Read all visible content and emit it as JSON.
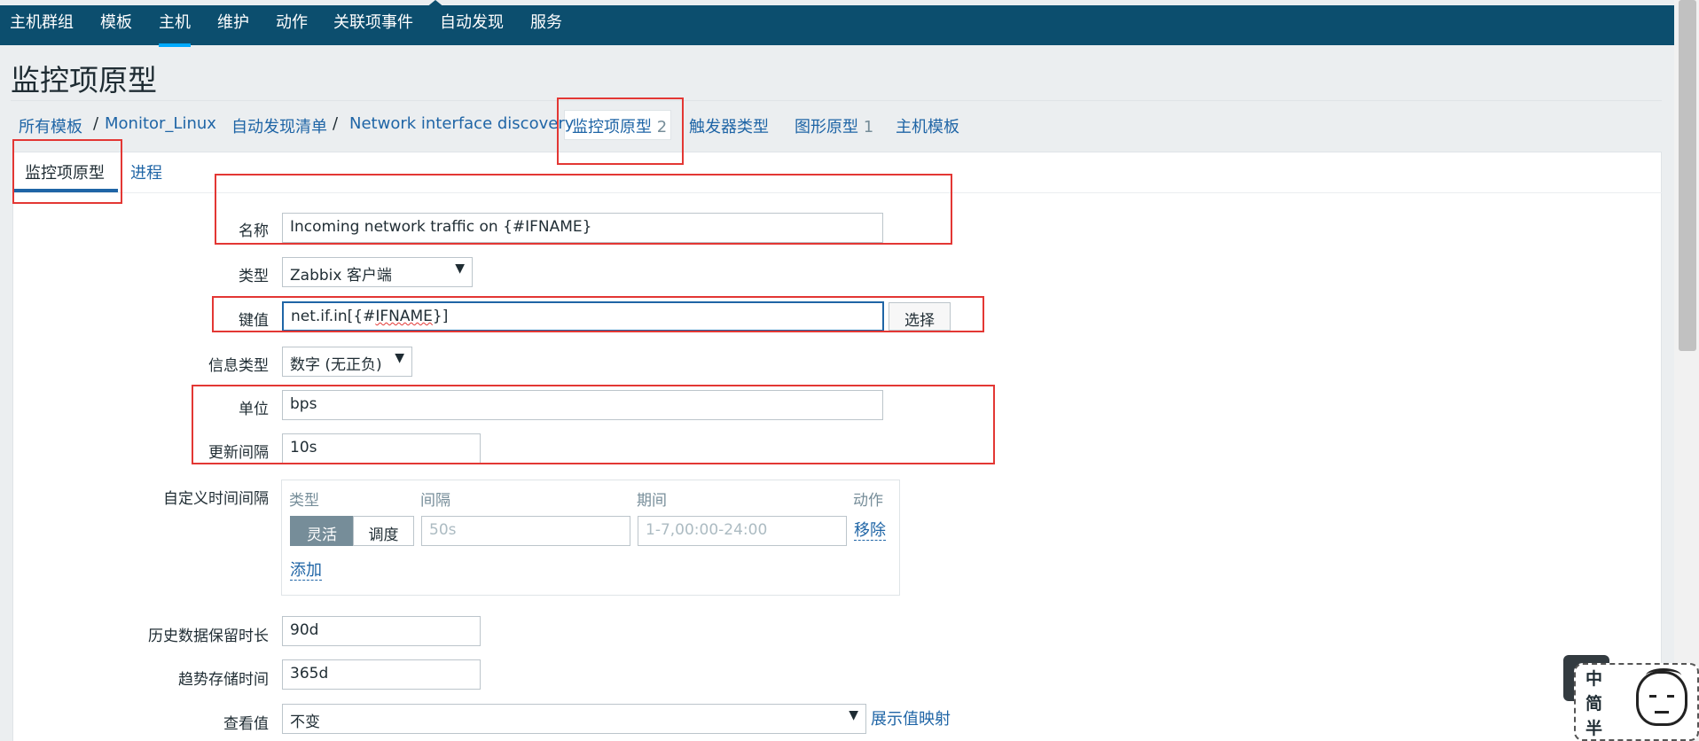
{
  "nav": {
    "items": [
      "主机群组",
      "模板",
      "主机",
      "维护",
      "动作",
      "关联项事件",
      "自动发现",
      "服务"
    ],
    "active": "主机"
  },
  "page": {
    "title": "监控项原型"
  },
  "breadcrumb": {
    "all_templates": "所有模板",
    "sep": "/",
    "template": "Monitor_Linux",
    "discovery_list": "自动发现清单",
    "discovery_rule": "Network interface discovery",
    "item_prototypes": "监控项原型",
    "item_prototypes_count": "2",
    "trigger_prototypes": "触发器类型",
    "graph_prototypes": "图形原型",
    "graph_prototypes_count": "1",
    "host_templates": "主机模板"
  },
  "tabs": [
    "监控项原型",
    "进程"
  ],
  "form": {
    "name_label": "名称",
    "name_value": "Incoming network traffic on {#IFNAME}",
    "type_label": "类型",
    "type_value": "Zabbix 客户端",
    "key_label": "键值",
    "key_prefix": "net.if.in[{#",
    "key_squiggle": "IFNAME",
    "key_suffix": "}]",
    "key_select_button": "选择",
    "info_type_label": "信息类型",
    "info_type_value": "数字 (无正负)",
    "units_label": "单位",
    "units_value": "bps",
    "interval_label": "更新间隔",
    "interval_value": "10s",
    "custom_interval_label": "自定义时间间隔",
    "custom_interval": {
      "col_type": "类型",
      "col_interval": "间隔",
      "col_period": "期间",
      "col_action": "动作",
      "flexible": "灵活",
      "scheduling": "调度",
      "interval_placeholder": "50s",
      "period_placeholder": "1-7,00:00-24:00",
      "remove": "移除",
      "add": "添加"
    },
    "history_label": "历史数据保留时长",
    "history_value": "90d",
    "trends_label": "趋势存储时间",
    "trends_value": "365d",
    "show_value_label": "查看值",
    "show_value_value": "不变",
    "show_value_mapping": "展示值映射"
  },
  "widget": {
    "text": [
      "中",
      "简",
      "半"
    ]
  },
  "colors": {
    "nav_bg": "#0c4e6e",
    "link": "#1f65a6",
    "annotation": "#e33734"
  }
}
